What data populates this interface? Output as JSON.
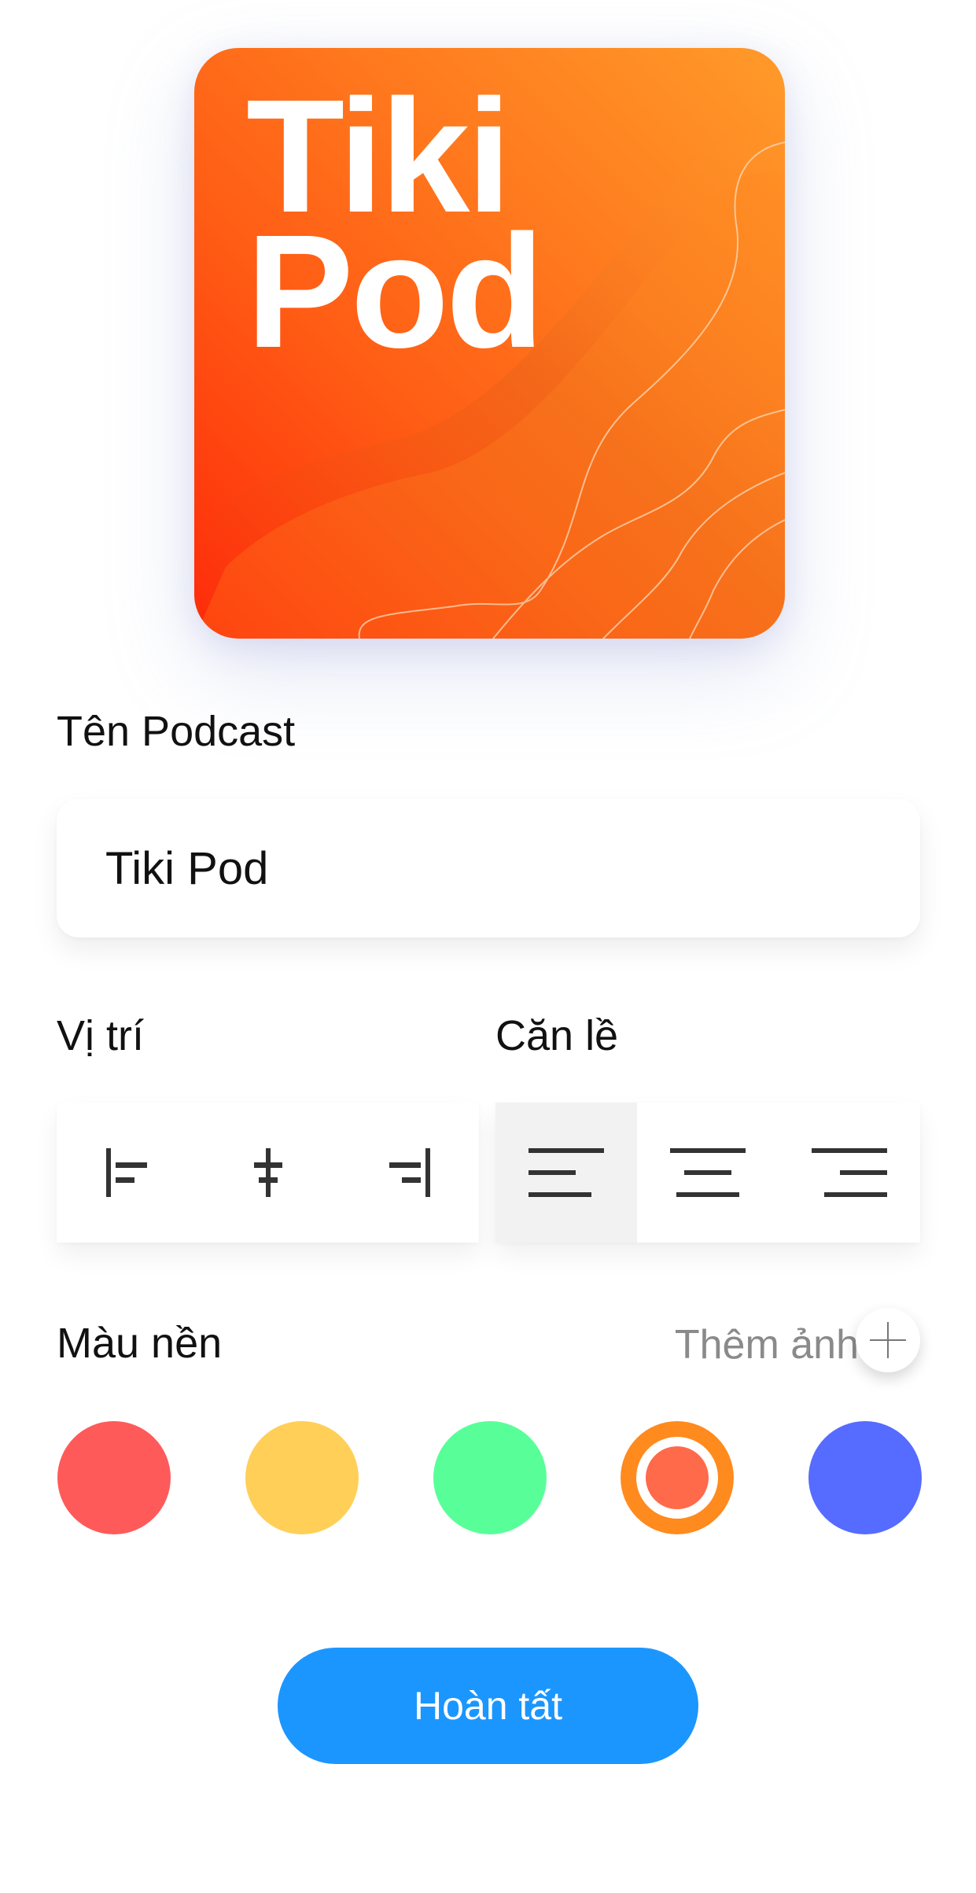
{
  "cover": {
    "line1": "Tiki",
    "line2": "Pod",
    "colors": {
      "top": "#ff9a2a",
      "bottom": "#ff2a0a",
      "text": "#ffffff"
    }
  },
  "name_section": {
    "label": "Tên Podcast",
    "value": "Tiki Pod"
  },
  "position_section": {
    "label": "Vị trí",
    "options": [
      {
        "icon": "align-left-edge-icon"
      },
      {
        "icon": "align-center-edge-icon"
      },
      {
        "icon": "align-right-edge-icon"
      }
    ]
  },
  "alignment_section": {
    "label": "Căn lề",
    "selected_index": 0,
    "options": [
      {
        "icon": "text-align-left-icon"
      },
      {
        "icon": "text-align-center-icon"
      },
      {
        "icon": "text-align-right-icon"
      }
    ]
  },
  "background_section": {
    "label": "Màu nền",
    "add_photo_label": "Thêm ảnh",
    "add_icon": "plus-icon",
    "selected_index": 3,
    "swatches": [
      {
        "color": "#ff5a5a"
      },
      {
        "color": "#ffcf57"
      },
      {
        "color": "#58ff98"
      },
      {
        "color": "#ff6a4a",
        "ring": "#ff8a1e"
      },
      {
        "color": "#566bff"
      }
    ]
  },
  "done_button": {
    "label": "Hoàn tất",
    "color": "#1b96ff"
  }
}
